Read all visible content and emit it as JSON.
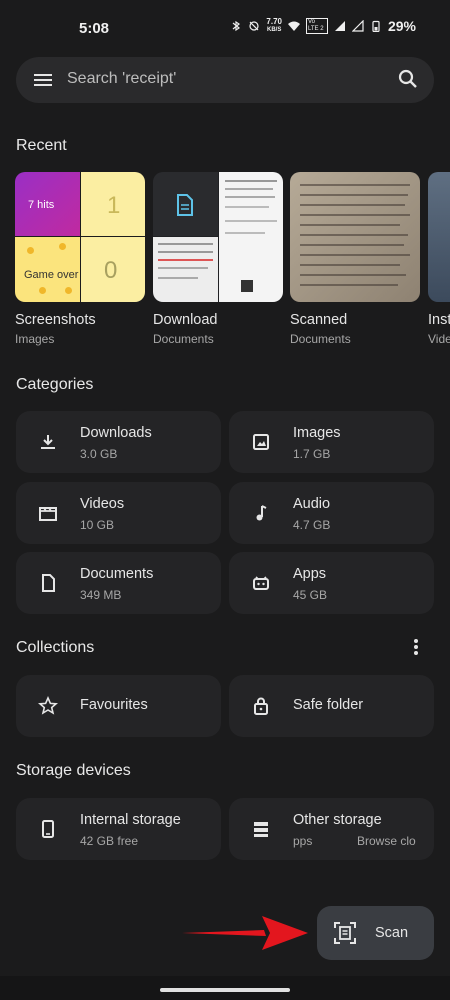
{
  "status": {
    "time": "5:08",
    "speed": "7.70",
    "speed_unit": "KB/S",
    "volte": "Vo LTE 2",
    "battery": "29%"
  },
  "search": {
    "placeholder": "Search 'receipt'"
  },
  "sections": {
    "recent": "Recent",
    "categories": "Categories",
    "collections": "Collections",
    "storage": "Storage devices"
  },
  "recent": [
    {
      "title": "Screenshots",
      "sub": "Images",
      "thumb_text": {
        "hits": "7 hits",
        "score1": "1",
        "game_over": "Game over",
        "score0": "0"
      }
    },
    {
      "title": "Download",
      "sub": "Documents"
    },
    {
      "title": "Scanned",
      "sub": "Documents"
    },
    {
      "title": "Inst",
      "sub": "Vide"
    }
  ],
  "categories": [
    {
      "title": "Downloads",
      "sub": "3.0 GB",
      "icon": "download-icon"
    },
    {
      "title": "Images",
      "sub": "1.7 GB",
      "icon": "image-icon"
    },
    {
      "title": "Videos",
      "sub": "10 GB",
      "icon": "video-icon"
    },
    {
      "title": "Audio",
      "sub": "4.7 GB",
      "icon": "music-note-icon"
    },
    {
      "title": "Documents",
      "sub": "349 MB",
      "icon": "document-icon"
    },
    {
      "title": "Apps",
      "sub": "45 GB",
      "icon": "android-icon"
    }
  ],
  "collections": [
    {
      "title": "Favourites",
      "icon": "star-icon"
    },
    {
      "title": "Safe folder",
      "icon": "lock-icon"
    }
  ],
  "storage": [
    {
      "title": "Internal storage",
      "sub": "42 GB free",
      "icon": "phone-icon"
    },
    {
      "title": "Other storage",
      "sub": "pps",
      "sub2": "Browse clo",
      "icon": "storage-icon"
    }
  ],
  "fab": {
    "label": "Scan"
  },
  "colors": {
    "background": "#1b1b1c",
    "tile": "#242426",
    "fab": "#3a3d42",
    "arrow": "#e3161e",
    "doc_accent": "#5ec3e8"
  }
}
